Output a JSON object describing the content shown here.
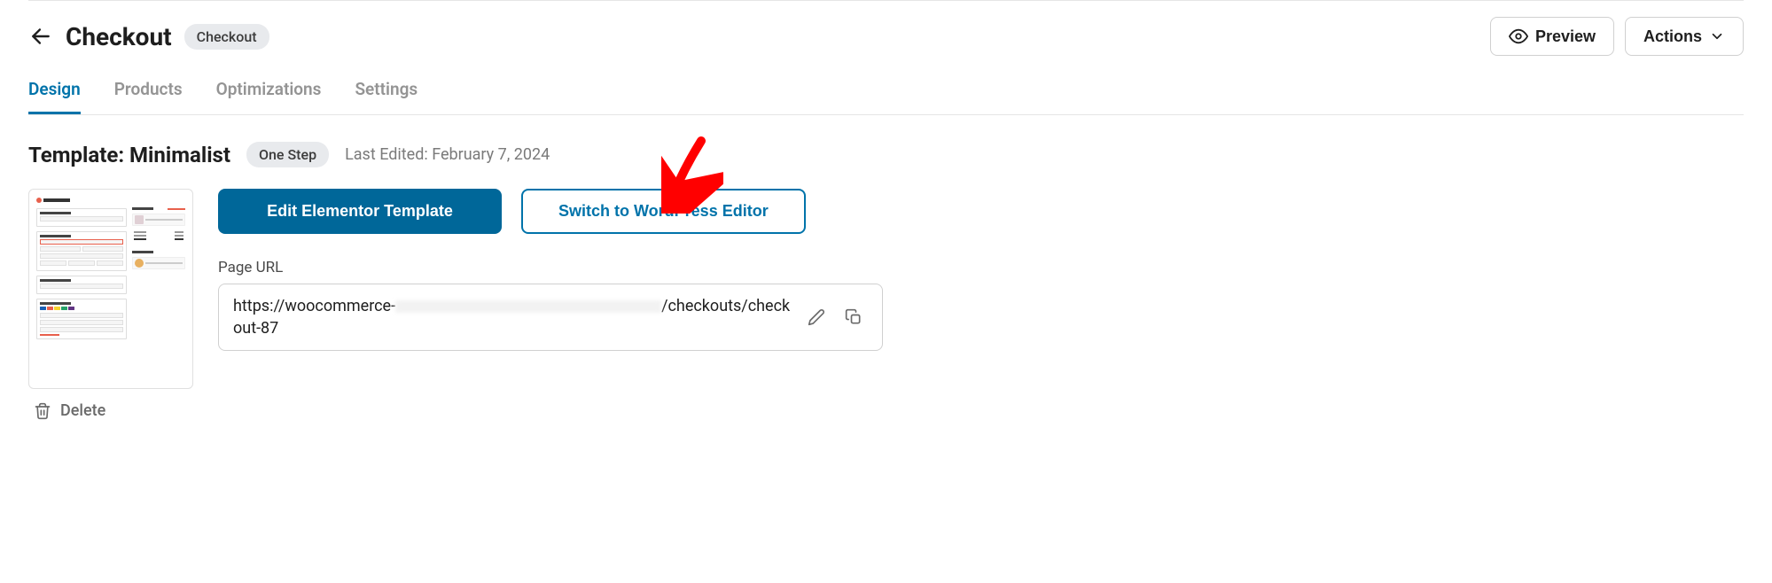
{
  "header": {
    "title": "Checkout",
    "badge": "Checkout",
    "preview_label": "Preview",
    "actions_label": "Actions"
  },
  "tabs": [
    {
      "label": "Design",
      "active": true
    },
    {
      "label": "Products",
      "active": false
    },
    {
      "label": "Optimizations",
      "active": false
    },
    {
      "label": "Settings",
      "active": false
    }
  ],
  "meta": {
    "template_title": "Template: Minimalist",
    "step_badge": "One Step",
    "last_edited": "Last Edited: February 7, 2024"
  },
  "buttons": {
    "edit_primary": "Edit Elementor Template",
    "switch_secondary": "Switch to WordPress Editor"
  },
  "page_url": {
    "label": "Page URL",
    "value_prefix": "https://woocommerce-",
    "value_suffix": "/checkouts/checkout-87"
  },
  "actions": {
    "delete_label": "Delete"
  }
}
